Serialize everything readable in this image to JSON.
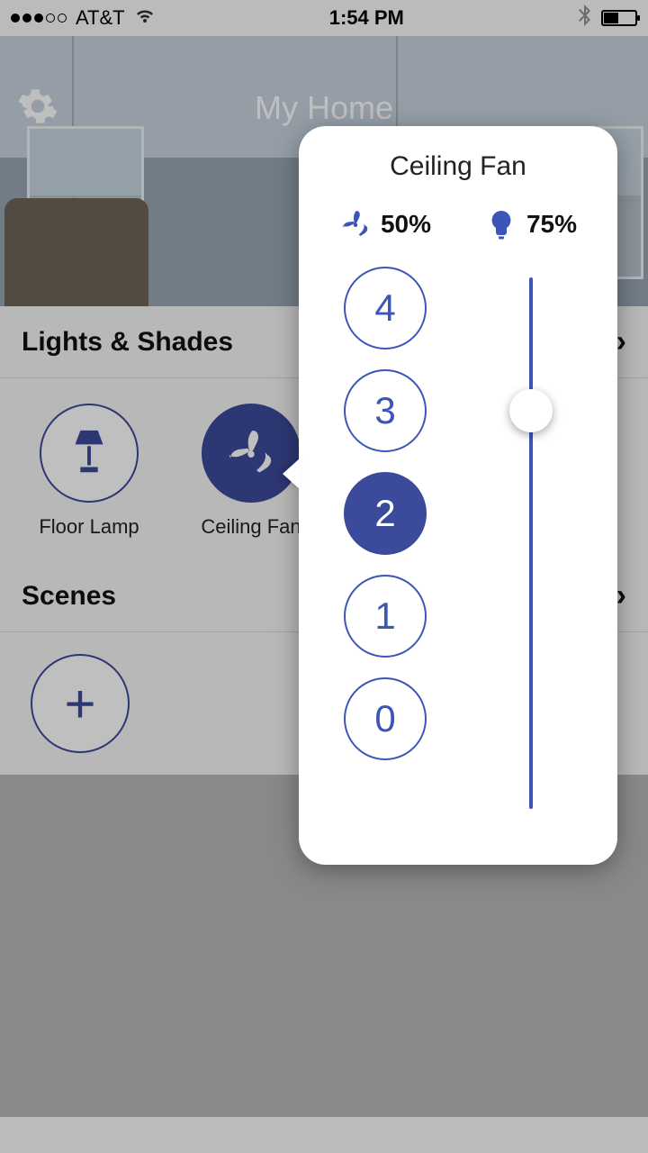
{
  "status": {
    "carrier": "AT&T",
    "time": "1:54 PM"
  },
  "header": {
    "title": "My Home"
  },
  "sections": {
    "lights_shades": {
      "title": "Lights & Shades"
    },
    "scenes": {
      "title": "Scenes"
    }
  },
  "devices": [
    {
      "name": "Floor Lamp"
    },
    {
      "name": "Ceiling Fan"
    }
  ],
  "popover": {
    "title": "Ceiling Fan",
    "fan_percent": "50%",
    "light_percent": "75%",
    "speeds": [
      "4",
      "3",
      "2",
      "1",
      "0"
    ],
    "active_speed": "2",
    "light_slider_value": 75
  }
}
